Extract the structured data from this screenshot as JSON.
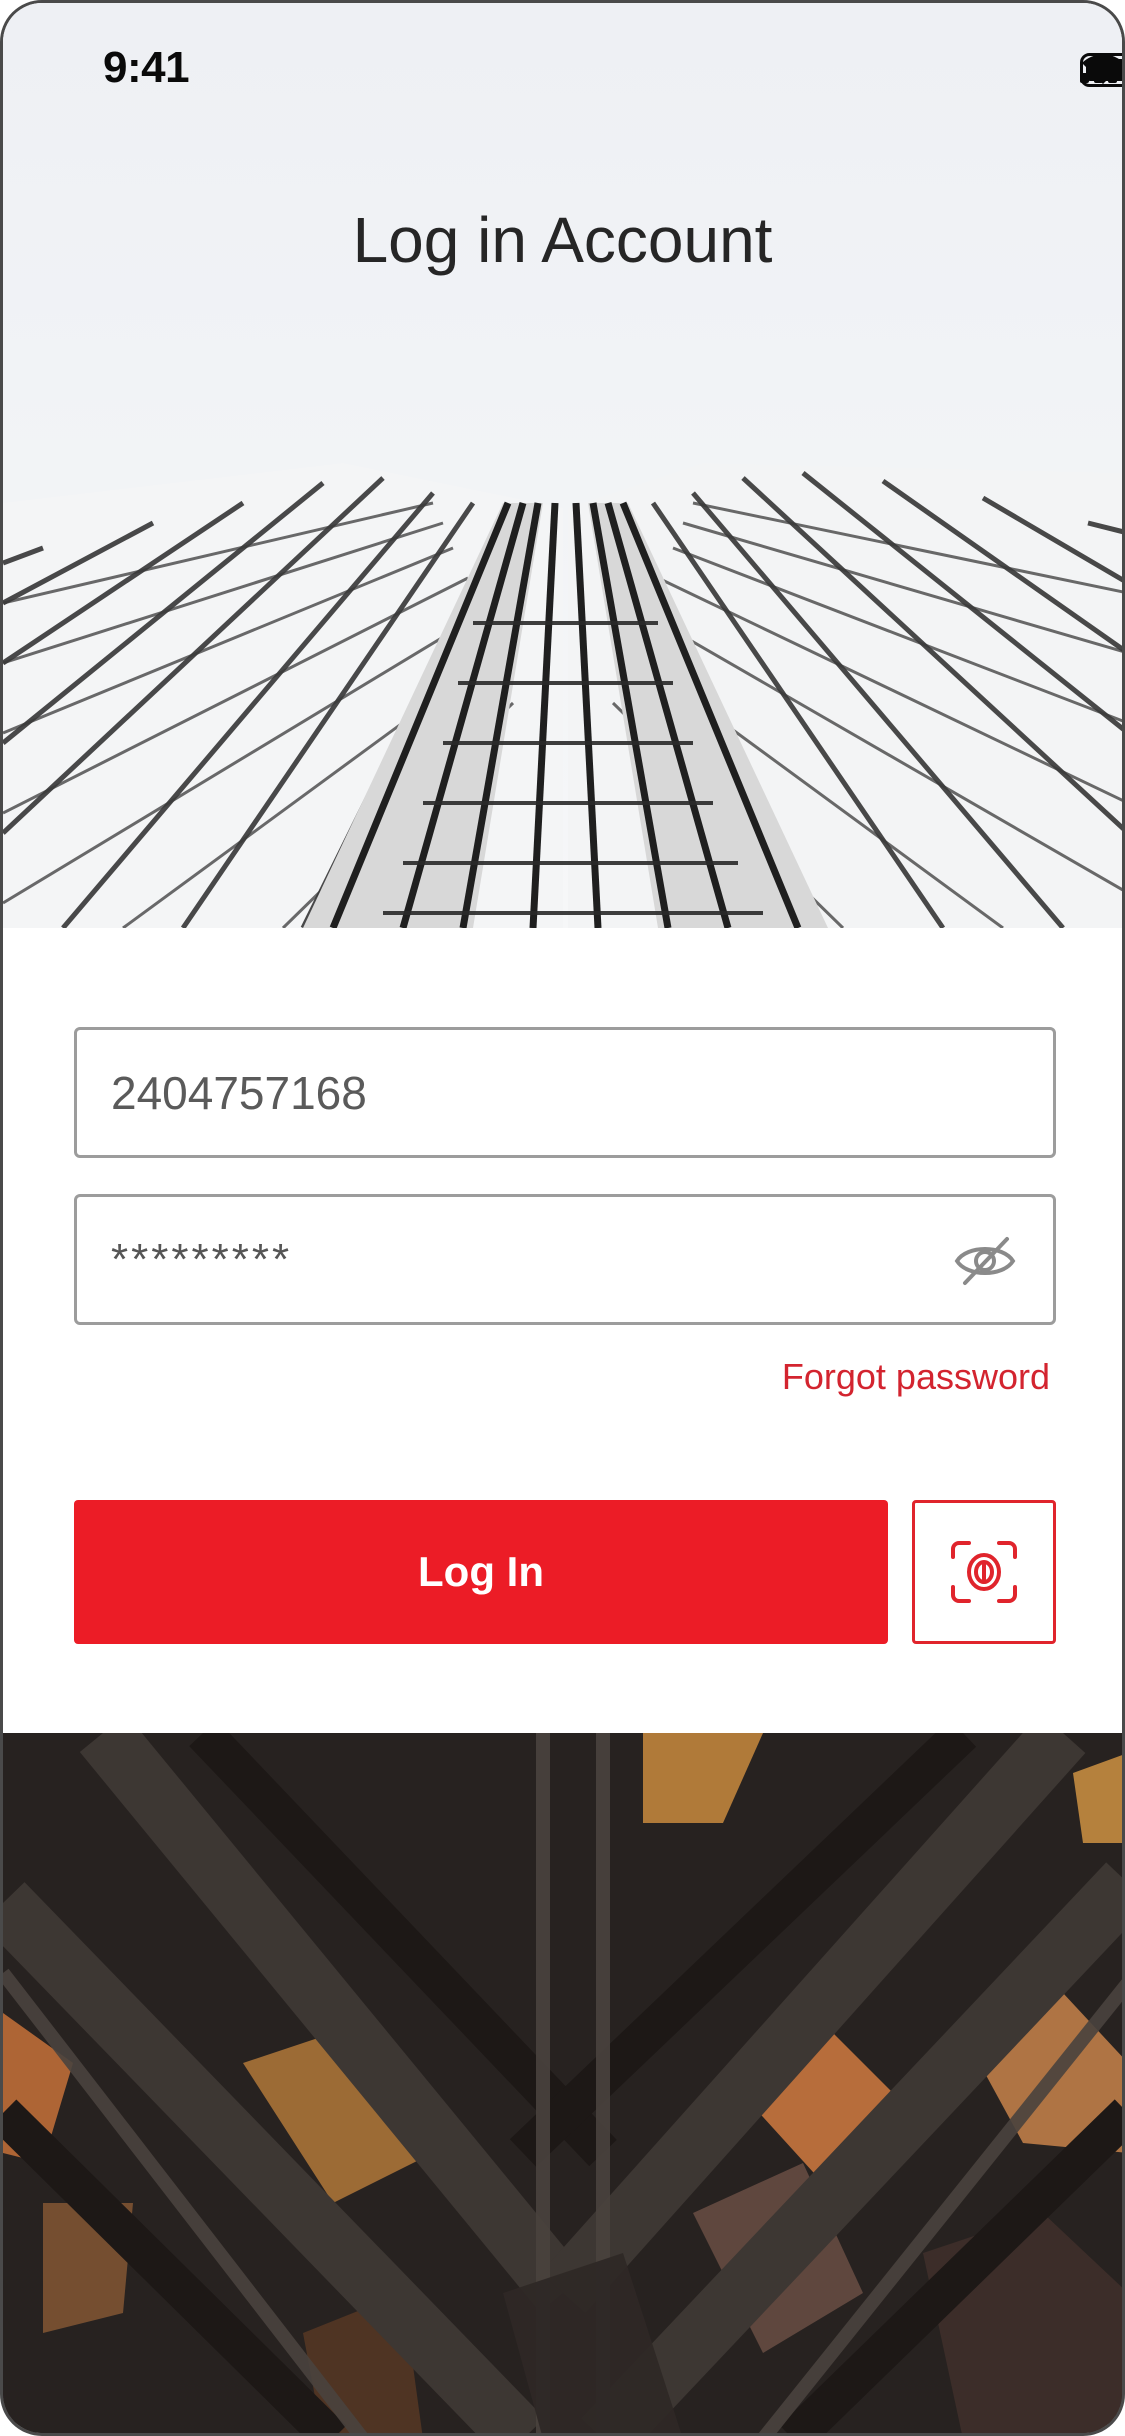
{
  "status_bar": {
    "time": "9:41",
    "icons": [
      "signal-icon",
      "wifi-icon",
      "battery-icon"
    ]
  },
  "header": {
    "title": "Log in Account"
  },
  "form": {
    "phone_value": "2404757168",
    "password_mask": "*********",
    "password_toggle_icon": "eye-slash-icon",
    "forgot_label": "Forgot password"
  },
  "actions": {
    "login_label": "Log In",
    "biometric_icon": "face-id-icon"
  },
  "colors": {
    "accent": "#ec1c26",
    "link": "#d3242f",
    "title": "#262626"
  }
}
